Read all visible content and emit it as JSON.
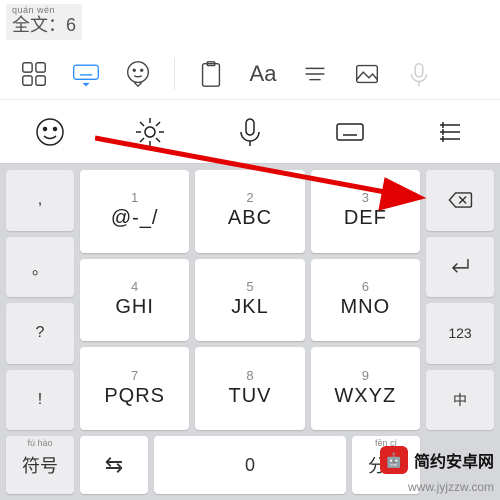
{
  "suggest": {
    "pinyin": "quán wén",
    "text": "全文：6"
  },
  "toolbar": {
    "items": [
      {
        "name": "apps-icon"
      },
      {
        "name": "keyboard-icon",
        "active": true
      },
      {
        "name": "emoji-alt-icon"
      },
      {
        "name": "clipboard-icon"
      },
      {
        "name": "font-icon",
        "label": "Aa"
      },
      {
        "name": "align-icon"
      },
      {
        "name": "image-icon"
      },
      {
        "name": "mic-gray-icon"
      }
    ]
  },
  "func": [
    {
      "name": "emoji-icon"
    },
    {
      "name": "gear-icon"
    },
    {
      "name": "mic-icon"
    },
    {
      "name": "keyboard-small-icon"
    },
    {
      "name": "menu-lines-icon"
    }
  ],
  "left_punct": [
    ",",
    "。",
    "?",
    "!"
  ],
  "keys": [
    [
      {
        "n": "1",
        "a": "@-_/"
      },
      {
        "n": "2",
        "a": "ABC"
      },
      {
        "n": "3",
        "a": "DEF"
      }
    ],
    [
      {
        "n": "4",
        "a": "GHI"
      },
      {
        "n": "5",
        "a": "JKL"
      },
      {
        "n": "6",
        "a": "MNO"
      }
    ],
    [
      {
        "n": "7",
        "a": "PQRS"
      },
      {
        "n": "8",
        "a": "TUV"
      },
      {
        "n": "9",
        "a": "WXYZ"
      }
    ]
  ],
  "right": {
    "backspace": "⌫",
    "enter": "↵",
    "num": "123",
    "cn": "中"
  },
  "bottom": {
    "symbol_pin": "fú hào",
    "symbol": "符号",
    "swap": "⇆",
    "zero": "0",
    "space_pin": "fēn cí",
    "space": "分词"
  },
  "ad": {
    "brand": "简约安卓网",
    "url": "www.jyjzzw.com"
  }
}
